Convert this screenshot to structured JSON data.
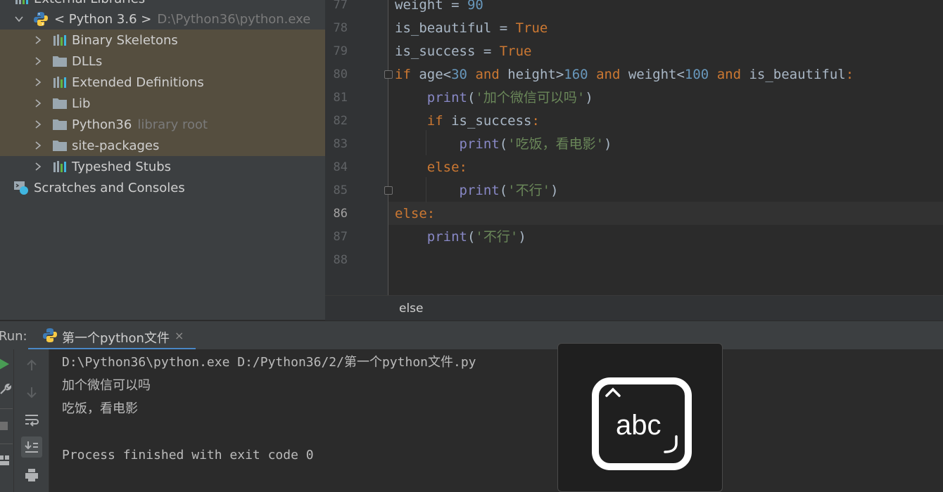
{
  "project_tree": {
    "items": [
      {
        "label": "External Libraries",
        "icon": "library-icon"
      },
      {
        "label": "< Python 3.6 >",
        "secondary": "D:\\Python36\\python.exe",
        "icon": "python-icon",
        "expanded": true
      },
      {
        "label": "Binary Skeletons",
        "icon": "library-icon"
      },
      {
        "label": "DLLs",
        "icon": "folder-icon"
      },
      {
        "label": "Extended Definitions",
        "icon": "library-icon"
      },
      {
        "label": "Lib",
        "icon": "folder-icon"
      },
      {
        "label": "Python36",
        "secondary": "library root",
        "icon": "folder-icon"
      },
      {
        "label": "site-packages",
        "icon": "folder-icon"
      },
      {
        "label": "Typeshed Stubs",
        "icon": "library-icon"
      },
      {
        "label": "Scratches and Consoles",
        "icon": "scratches-icon"
      }
    ]
  },
  "editor": {
    "current_line": 86,
    "line_numbers": [
      "77",
      "78",
      "79",
      "80",
      "81",
      "82",
      "83",
      "84",
      "85",
      "86",
      "87",
      "88"
    ],
    "lines": [
      "weight = 90",
      "is_beautiful = True",
      "is_success = True",
      "if age<30 and height>160 and weight<100 and is_beautiful:",
      "    print('加个微信可以吗')",
      "    if is_success:",
      "        print('吃饭，看电影')",
      "    else:",
      "        print('不行')",
      "else:",
      "    print('不行')",
      ""
    ],
    "breadcrumb": "else"
  },
  "run": {
    "label": "Run:",
    "tab_label": "第一个python文件",
    "close_glyph": "×",
    "output": [
      "D:\\Python36\\python.exe D:/Python36/2/第一个python文件.py",
      "加个微信可以吗",
      "吃饭，看电影",
      "",
      "Process finished with exit code 0"
    ]
  },
  "overlay": {
    "text": "abc",
    "icon": "input-method-abc-icon"
  },
  "colors": {
    "keyword": "#cc7832",
    "number": "#6897bb",
    "string": "#6a8759",
    "builtin": "#8888c6",
    "selection": "#554e3f",
    "run_green": "#499c54",
    "tab_underline": "#4a88c7"
  }
}
